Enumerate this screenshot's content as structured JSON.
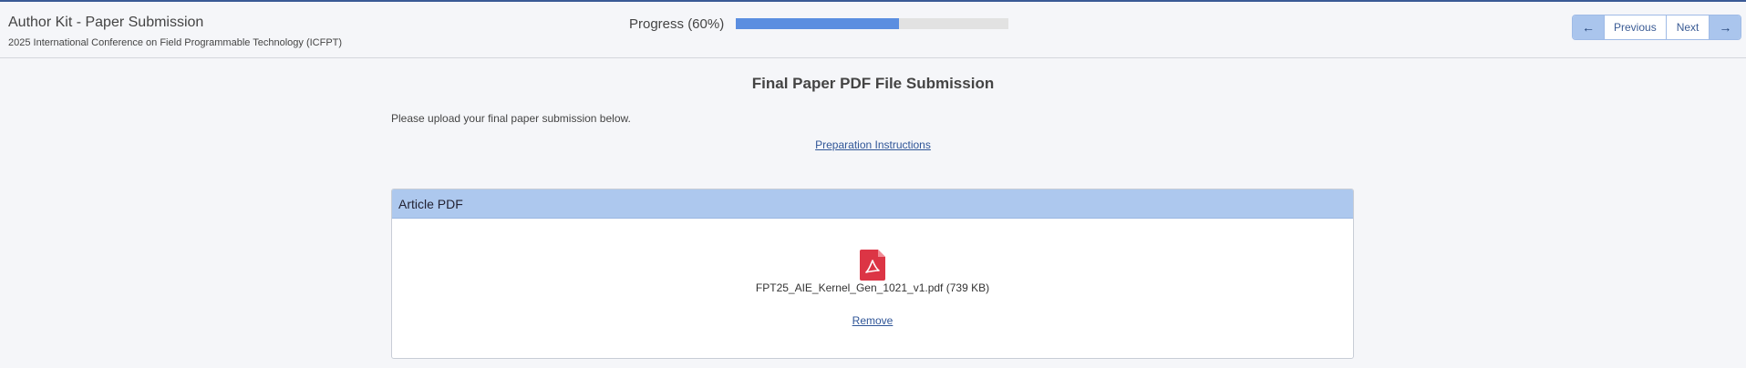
{
  "header": {
    "app_title": "Author Kit - Paper Submission",
    "conference": "2025 International Conference on Field Programmable Technology (ICFPT)",
    "progress_label": "Progress (60%)",
    "progress_value": 0.6,
    "prev_label": "Previous",
    "next_label": "Next",
    "accent_color": "#5b8ee0"
  },
  "main": {
    "title": "Final Paper PDF File Submission",
    "intro": "Please upload your final paper submission below.",
    "instructions_link": "Preparation Instructions",
    "card": {
      "header": "Article PDF",
      "file_icon": "pdf-file-icon",
      "file_name": "FPT25_AIE_Kernel_Gen_1021_v1.pdf",
      "file_size": "(739 KB)",
      "remove_label": "Remove"
    }
  }
}
